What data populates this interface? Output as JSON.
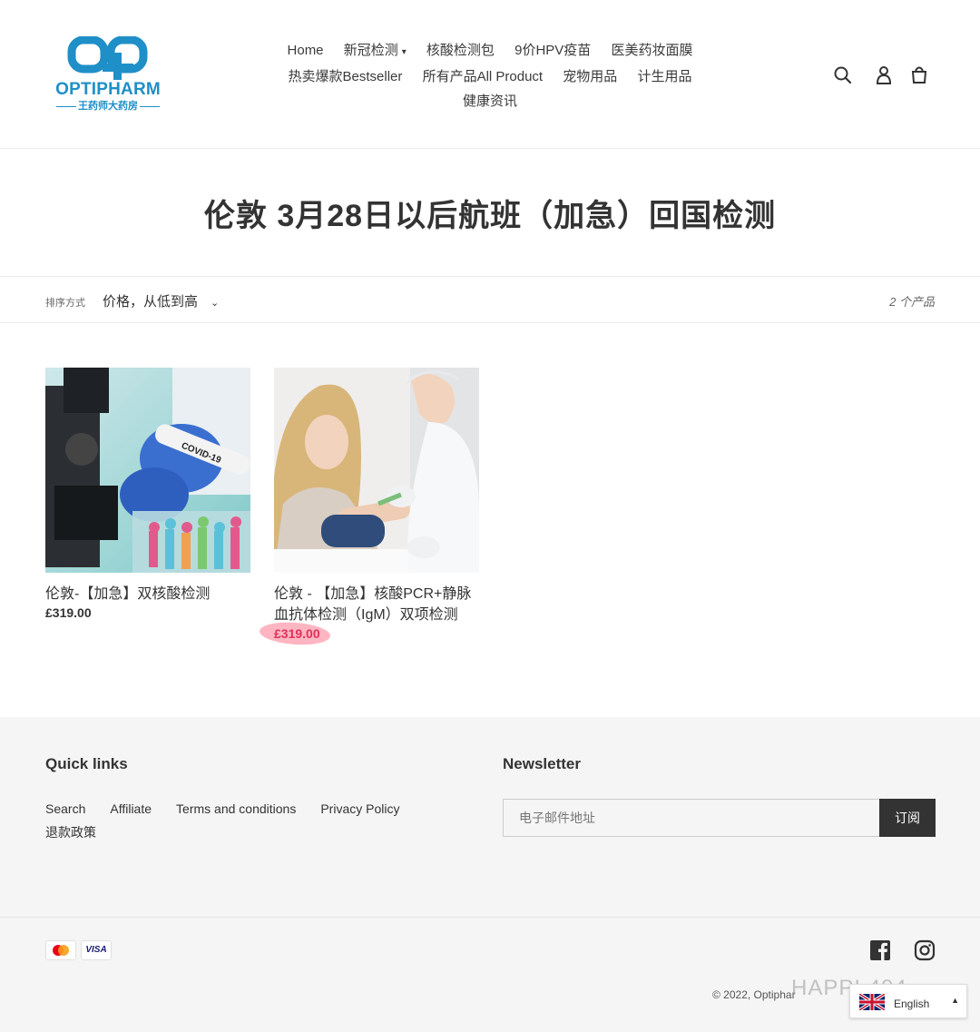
{
  "logo": {
    "brand": "OPTIPHARM",
    "subtitle": "王药师大药房"
  },
  "nav": {
    "row1": [
      "Home",
      "新冠检测",
      "核酸检测包",
      "9价HPV疫苗",
      "医美药妆面膜"
    ],
    "row2": [
      "热卖爆款Bestseller",
      "所有产品All Product",
      "宠物用品",
      "计生用品"
    ],
    "row3": [
      "健康资讯"
    ],
    "dropdown_chevron": "⌄"
  },
  "header_icons": [
    "search-icon",
    "account-icon",
    "cart-icon"
  ],
  "page_title": "伦敦 3月28日以后航班（加急）回国检测",
  "filter": {
    "sort_label": "排序方式",
    "sort_value": "价格，从低到高",
    "count": "2 个产品"
  },
  "products": [
    {
      "name": "伦敦-【加急】双核酸检测",
      "price": "£319.00",
      "image_label": "COVID-19"
    },
    {
      "name": "伦敦 - 【加急】核酸PCR+静脉血抗体检测（IgM）双项检测",
      "price": "£319.00"
    }
  ],
  "footer": {
    "quick_links_title": "Quick links",
    "links": [
      "Search",
      "Affiliate",
      "Terms and conditions",
      "Privacy Policy",
      "退款政策"
    ],
    "newsletter_title": "Newsletter",
    "email_placeholder": "电子邮件地址",
    "subscribe_label": "订阅",
    "payments": [
      "mastercard-icon",
      "VISA"
    ],
    "social": [
      "facebook-icon",
      "instagram-icon"
    ],
    "copyright": "© 2022, Optiphar",
    "watermark": "HAPPI 404",
    "language": "English"
  },
  "colors": {
    "brand": "#1f8fc7",
    "price_highlight": "#e0305a",
    "button": "#333333",
    "footer_bg": "#f5f5f5"
  }
}
